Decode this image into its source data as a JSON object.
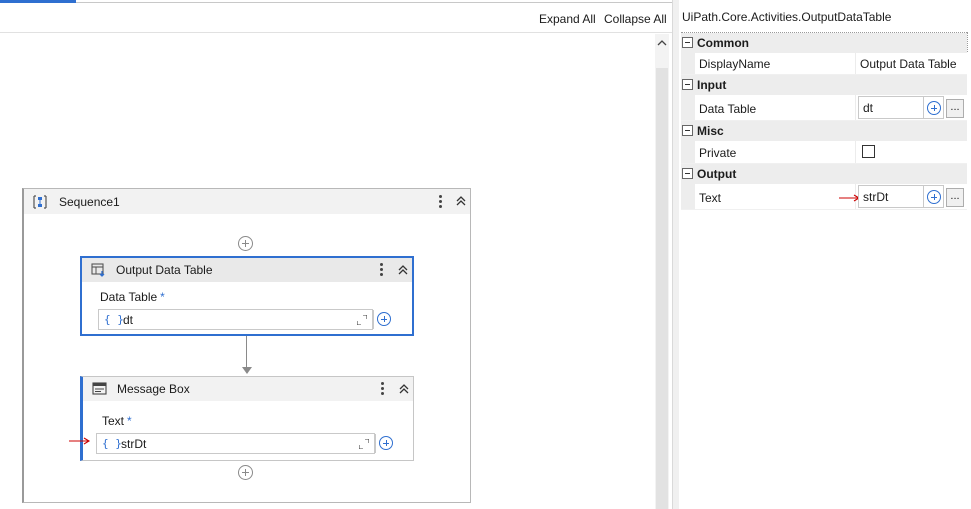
{
  "designer": {
    "expand_all": "Expand All",
    "collapse_all": "Collapse All",
    "sequence": {
      "title": "Sequence1"
    },
    "output_data_table": {
      "title": "Output Data Table",
      "field_label": "Data Table",
      "required_mark": "*",
      "curly": "{ }",
      "value": "dt"
    },
    "message_box": {
      "title": "Message Box",
      "field_label": "Text",
      "required_mark": "*",
      "curly": "{ }",
      "value": "strDt"
    }
  },
  "properties": {
    "title": "UiPath.Core.Activities.OutputDataTable",
    "categories": {
      "common": "Common",
      "input": "Input",
      "misc": "Misc",
      "output": "Output"
    },
    "rows": {
      "display_name": {
        "name": "DisplayName",
        "value": "Output Data Table"
      },
      "data_table": {
        "name": "Data Table",
        "value": "dt"
      },
      "private": {
        "name": "Private",
        "checked": false
      },
      "text": {
        "name": "Text",
        "value": "strDt"
      }
    },
    "ellipsis": "..."
  },
  "colors": {
    "accent": "#2f6fd0",
    "annotation_arrow": "#cc0000"
  }
}
